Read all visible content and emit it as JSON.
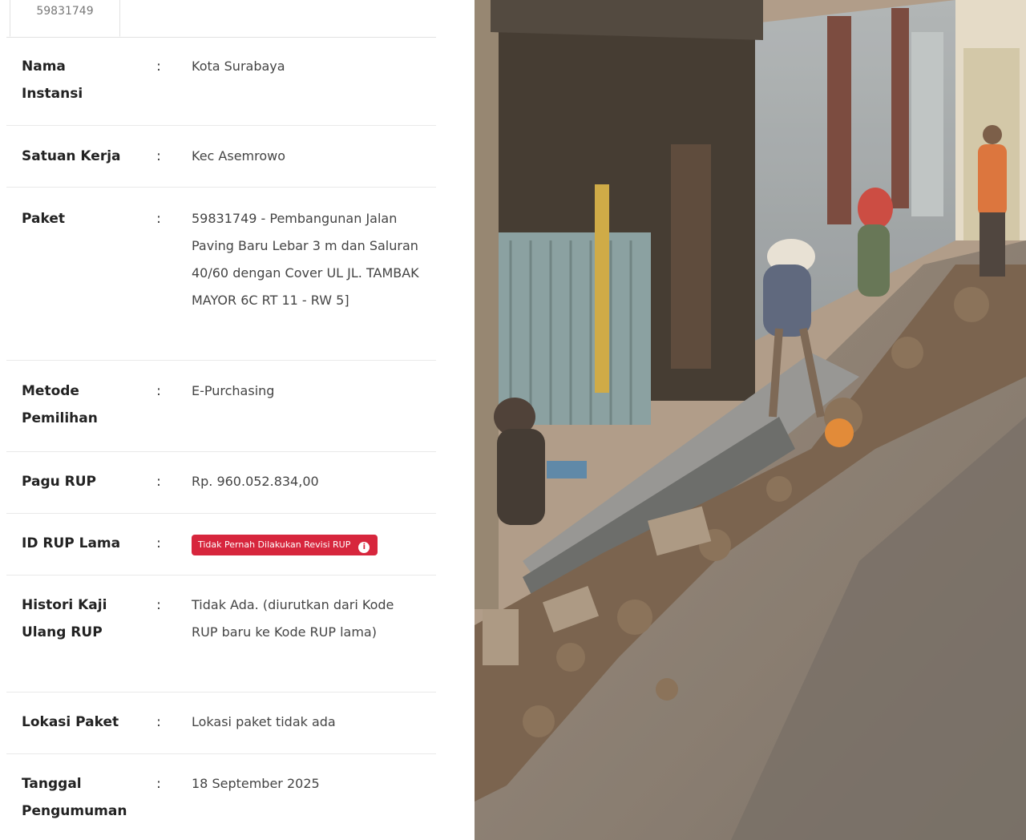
{
  "tab": {
    "label": "59831749"
  },
  "rows": [
    {
      "label": "Nama Instansi",
      "value": "Kota Surabaya"
    },
    {
      "label": "Satuan Kerja",
      "value": "Kec Asemrowo"
    },
    {
      "label": "Paket",
      "value": "59831749 - Pembangunan Jalan Paving Baru Lebar 3 m dan Saluran 40/60 dengan Cover UL JL. TAMBAK MAYOR 6C RT 11 - RW 5]"
    },
    {
      "label": "Metode Pemilihan",
      "value": "E-Purchasing"
    },
    {
      "label": "Pagu RUP",
      "value": "Rp. 960.052.834,00"
    },
    {
      "label": "ID RUP Lama",
      "badge": "Tidak Pernah Dilakukan Revisi RUP",
      "badge_icon": "info-icon"
    },
    {
      "label": "Histori Kaji Ulang RUP",
      "value": "Tidak Ada.   (diurutkan dari Kode RUP baru ke Kode RUP lama)"
    },
    {
      "label": "Lokasi Paket",
      "value": "Lokasi paket tidak ada"
    },
    {
      "label": "Tanggal Pengumuman",
      "value": "18 September 2025"
    }
  ],
  "separator": ":",
  "colors": {
    "badge": "#d7263d",
    "label_text": "#222222",
    "value_text": "#444444"
  },
  "photo": {
    "subject": "workers-digging-roadside-drainage-channel"
  }
}
